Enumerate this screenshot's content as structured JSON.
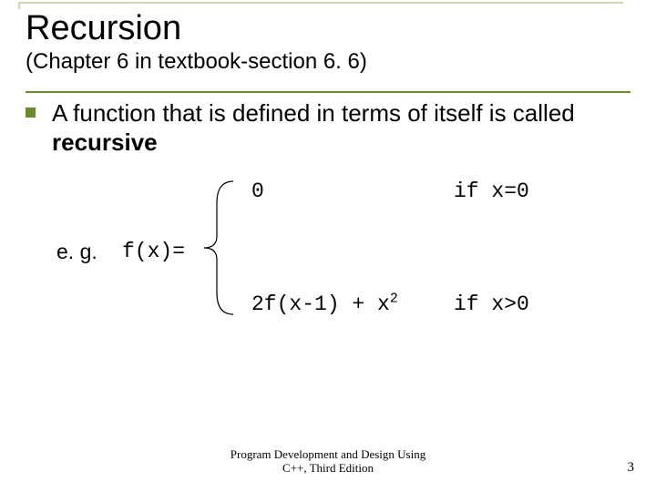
{
  "title": "Recursion",
  "subtitle": "(Chapter 6 in textbook-section 6. 6)",
  "bullet": {
    "pre": "A function that is defined in terms of itself is called ",
    "bold": "recursive"
  },
  "formula": {
    "eg": "e. g.",
    "fx": "f(x)=",
    "case0_val": "0",
    "case0_cond": "if x=0",
    "case1_pre": "2f(x-1) + x",
    "case1_exp": "2",
    "case1_cond": "if x>0"
  },
  "footer_line1": "Program Development and Design Using",
  "footer_line2": "C++, Third Edition",
  "page_number": "3"
}
